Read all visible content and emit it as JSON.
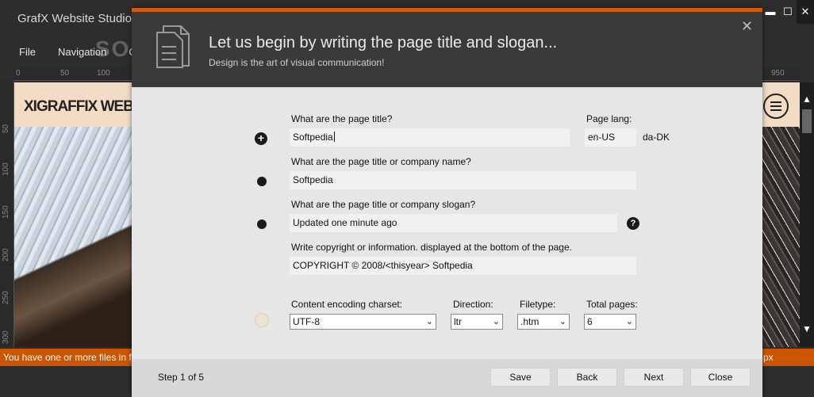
{
  "app": {
    "title": "GrafX Website Studio",
    "menu": [
      "File",
      "Navigation",
      "Conte"
    ],
    "ruler_top": [
      "0",
      "50",
      "100",
      "950"
    ],
    "ruler_left": [
      "50",
      "100",
      "150",
      "200",
      "250",
      "300"
    ],
    "site_logo": "XIGRAFFIX WEBD",
    "status_message": "You have one or more files in f",
    "status_unit": "px",
    "window_controls": {
      "minimize": "▬",
      "maximize": "☐",
      "close": "✕"
    },
    "watermark": "SOFTPEDIA"
  },
  "dialog": {
    "title": "Let us begin by writing the page title and slogan...",
    "subtitle": "Design is the art of visual communication!",
    "close_glyph": "✕",
    "fields": {
      "page_title_label": "What are the page title?",
      "page_title_value": "Softpedia",
      "page_lang_label": "Page lang:",
      "page_lang_value": "en-US",
      "page_lang_alt": "da-DK",
      "company_label": "What are the page title or company name?",
      "company_value": "Softpedia",
      "slogan_label": "What are the page title or company slogan?",
      "slogan_value": "Updated one minute ago",
      "copyright_label": "Write copyright or information. displayed at the bottom of the page.",
      "copyright_value": "COPYRIGHT © 2008/<thisyear> Softpedia",
      "charset_label": "Content encoding charset:",
      "charset_value": "UTF-8",
      "direction_label": "Direction:",
      "direction_value": "ltr",
      "filetype_label": "Filetype:",
      "filetype_value": ".htm",
      "pages_label": "Total pages:",
      "pages_value": "6"
    },
    "help_glyph": "?",
    "plus_glyph": "+",
    "footer": {
      "step": "Step 1 of 5",
      "save": "Save",
      "back": "Back",
      "next": "Next",
      "close": "Close"
    }
  },
  "colors": {
    "accent": "#d05a10",
    "status_bar": "#cc5500",
    "dialog_header": "#3a3a3a"
  }
}
